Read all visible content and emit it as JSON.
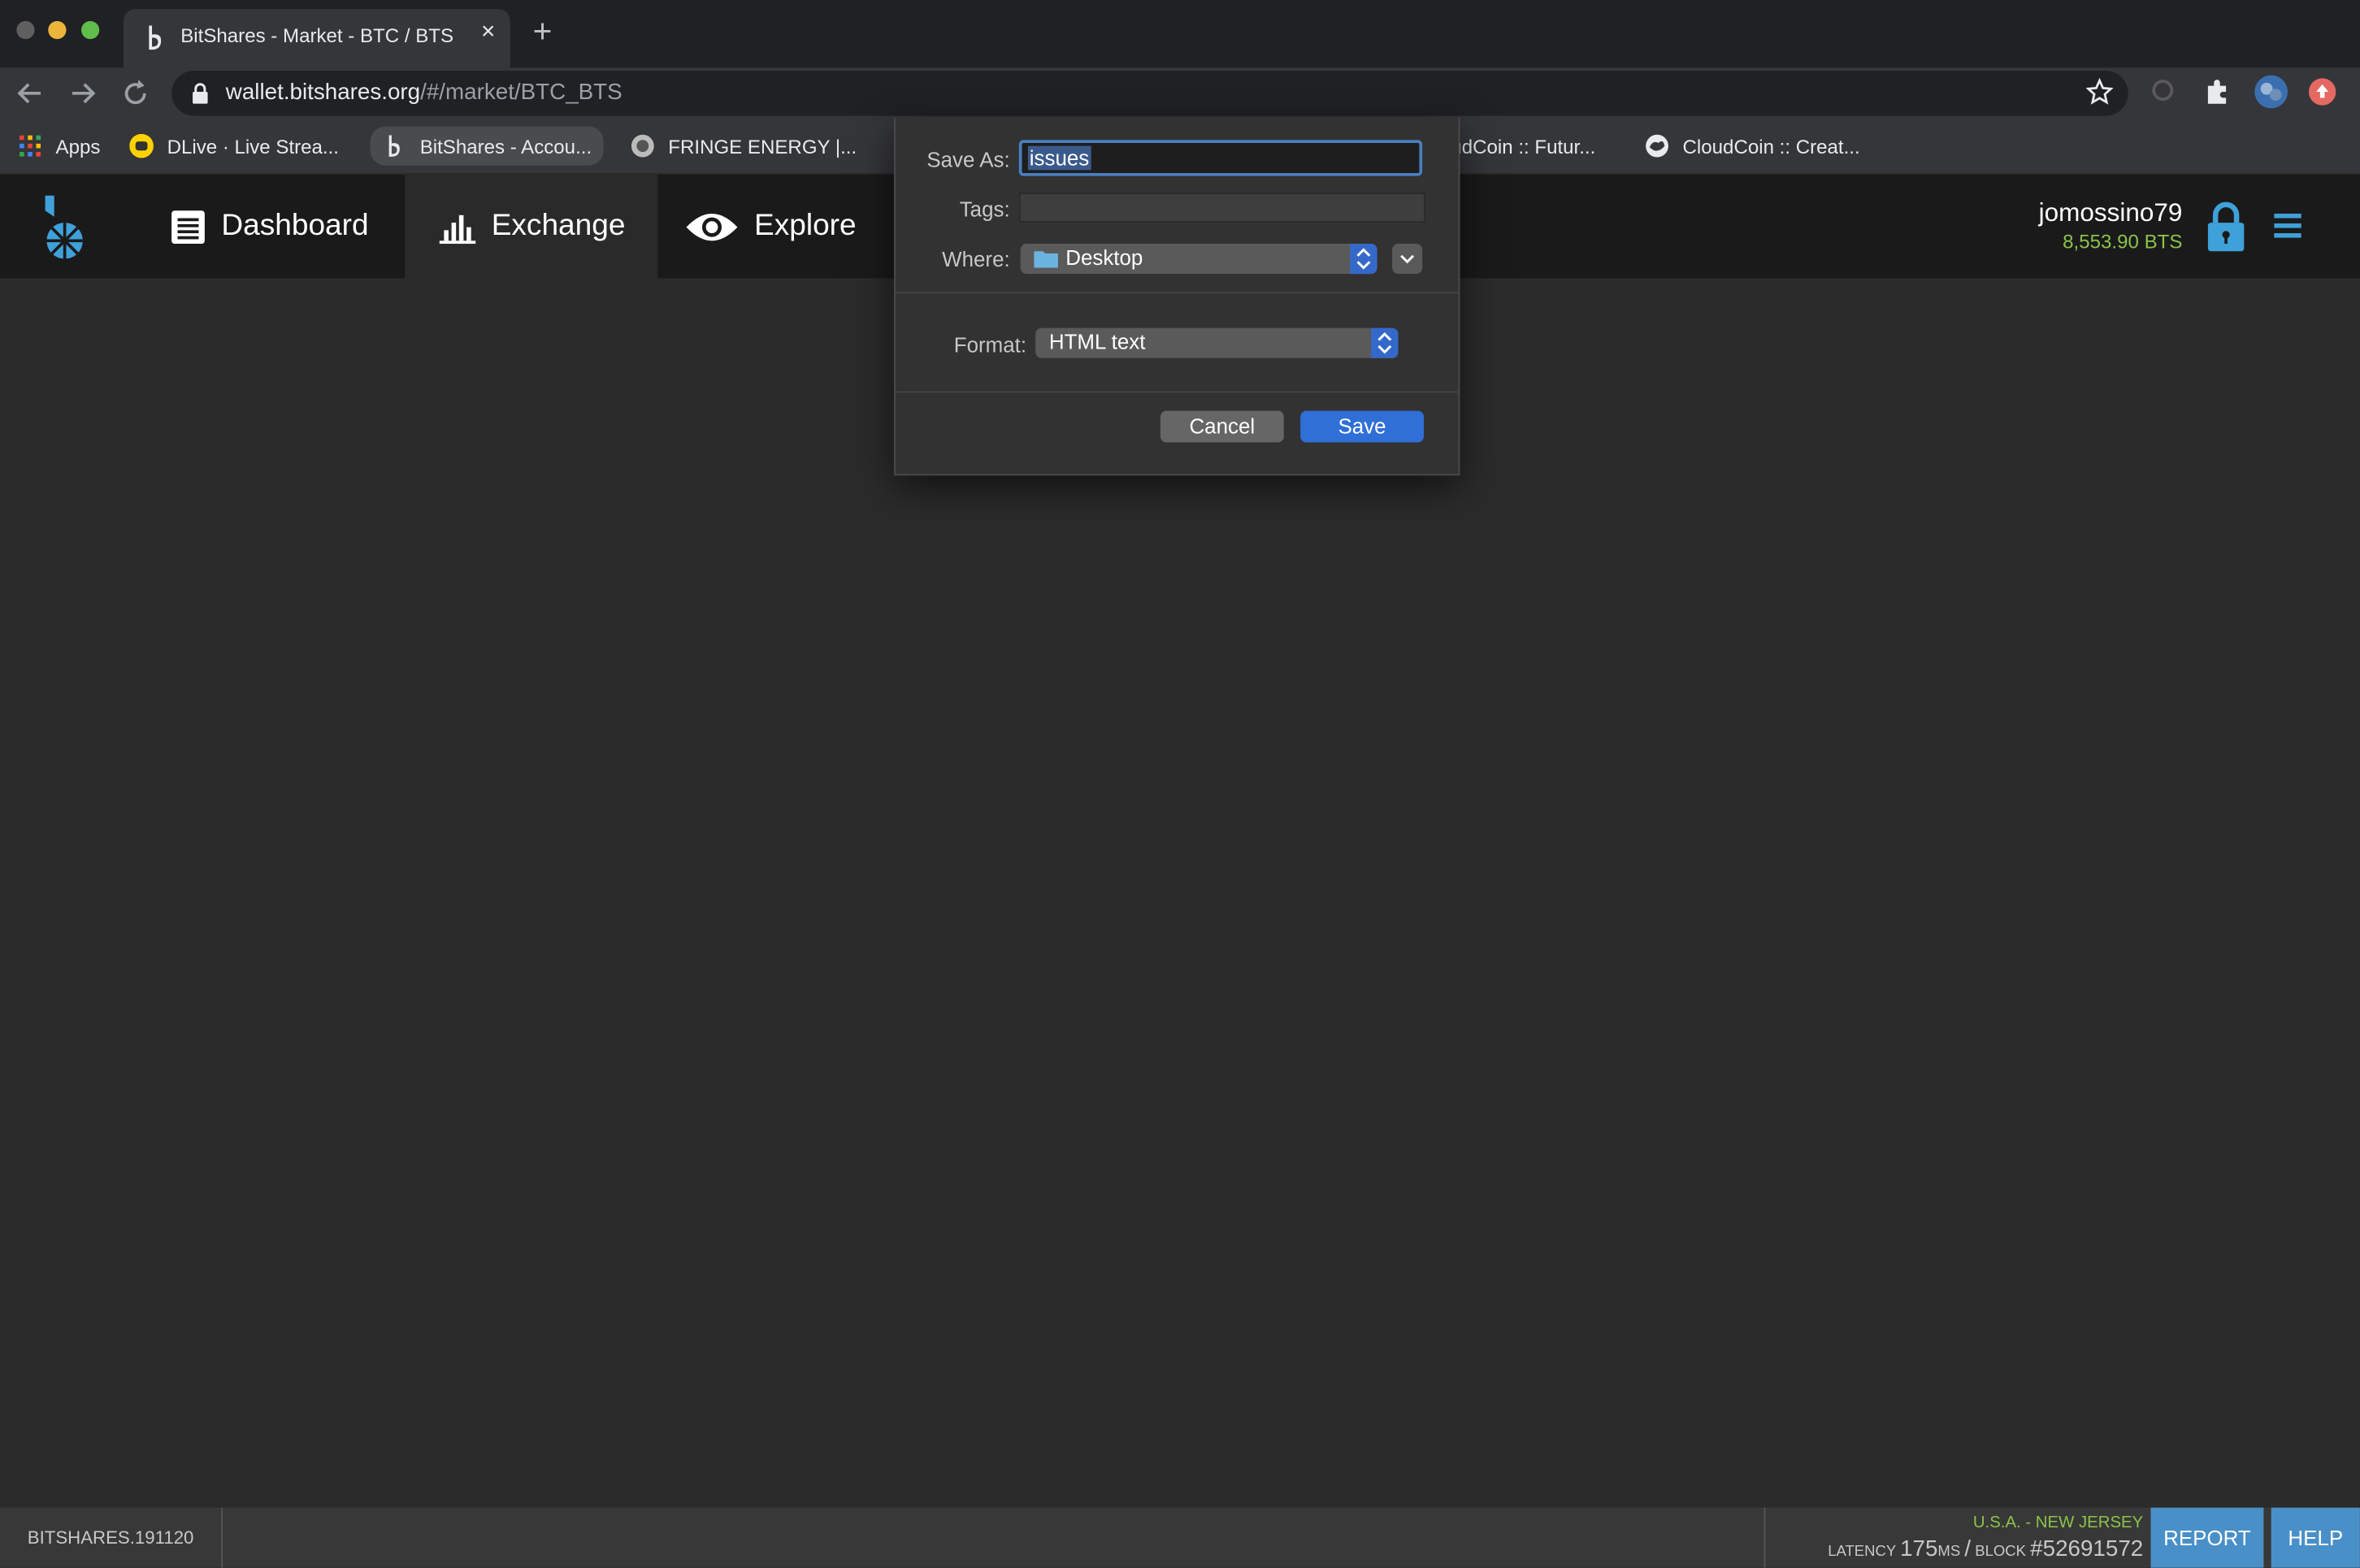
{
  "browser": {
    "tab_title": "BitShares - Market - BTC / BTS",
    "url_host": "wallet.bitshares.org",
    "url_path": "/#/market/BTC_BTS",
    "bookmarks": [
      {
        "label": "Apps",
        "icon": "apps-grid-icon"
      },
      {
        "label": "DLive · Live Strea...",
        "icon": "dlive-icon"
      },
      {
        "label": "BitShares - Accou...",
        "icon": "bitshares-icon"
      },
      {
        "label": "FRINGE ENERGY |...",
        "icon": "fringe-energy-icon"
      },
      {
        "label": "udCoin :: Futur...",
        "icon": ""
      },
      {
        "label": "CloudCoin :: Creat...",
        "icon": "cloudcoin-icon"
      }
    ]
  },
  "app": {
    "nav": [
      {
        "label": "Dashboard",
        "icon": "dashboard-icon"
      },
      {
        "label": "Exchange",
        "icon": "exchange-chart-icon"
      },
      {
        "label": "Explore",
        "icon": "eye-icon"
      }
    ],
    "account_name": "jomossino79",
    "account_balance": "8,553.90 BTS",
    "colors": {
      "accent": "#4a90c8",
      "positive": "#8bc34a",
      "header_bg": "#1a1a1a",
      "body_bg": "#2b2b2b"
    }
  },
  "dialog": {
    "save_as_label": "Save As:",
    "save_as_value": "issues",
    "tags_label": "Tags:",
    "where_label": "Where:",
    "where_value": "Desktop",
    "format_label": "Format:",
    "format_value": "HTML text",
    "cancel_label": "Cancel",
    "save_label": "Save"
  },
  "footer": {
    "version": "BITSHARES.191120",
    "location": "U.S.A. - NEW JERSEY",
    "latency_label": "LATENCY",
    "latency_value": "175",
    "latency_unit": "MS",
    "block_label": "BLOCK",
    "block_value": "#52691572",
    "report_label": "REPORT",
    "help_label": "HELP"
  }
}
